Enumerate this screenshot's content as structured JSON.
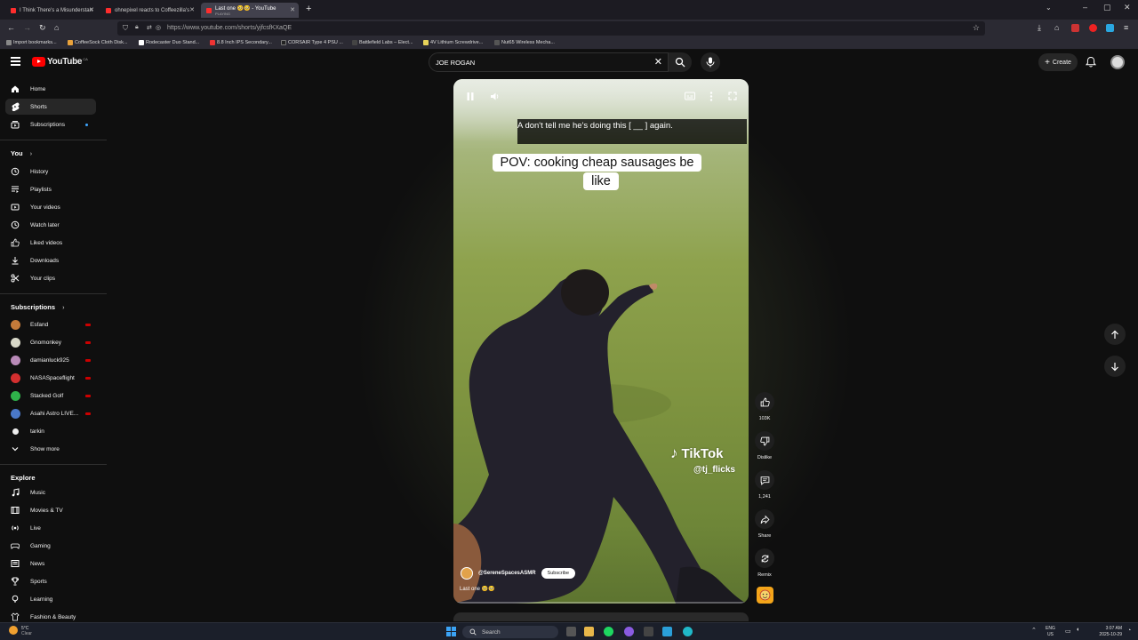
{
  "browser": {
    "tabs": [
      {
        "title": "I Think There's a Misunderstan",
        "active": false
      },
      {
        "title": "ohnepixel reacts to Coffeezilla's",
        "active": false
      },
      {
        "title": "Last one 🥺🥺 - YouTube",
        "subtitle": "PLAYING",
        "active": true
      }
    ],
    "url": "https://www.youtube.com/shorts/yjfcsfKXaQE",
    "bookmarks": [
      "Import bookmarks...",
      "CoffeeSock Cloth Disk...",
      "Rodecaster Duo Stand...",
      "8.8 Inch IPS Secondary...",
      "CORSAIR Type 4 PSU ...",
      "Battlefield Labs – Elect...",
      "4V Lithium Screwdrive...",
      "Nut65 Wireless Mecha..."
    ]
  },
  "header": {
    "logo_text": "YouTube",
    "country": "CA",
    "search_value": "JOE ROGAN",
    "create_label": "Create"
  },
  "sidebar": {
    "main": [
      {
        "label": "Home",
        "icon": "home-icon",
        "active": false
      },
      {
        "label": "Shorts",
        "icon": "shorts-icon",
        "active": true
      },
      {
        "label": "Subscriptions",
        "icon": "subscriptions-icon",
        "active": false
      }
    ],
    "you_heading": "You",
    "you": [
      {
        "label": "History",
        "icon": "history-icon"
      },
      {
        "label": "Playlists",
        "icon": "playlists-icon"
      },
      {
        "label": "Your videos",
        "icon": "your-videos-icon"
      },
      {
        "label": "Watch later",
        "icon": "watch-later-icon"
      },
      {
        "label": "Liked videos",
        "icon": "like-icon"
      },
      {
        "label": "Downloads",
        "icon": "download-icon"
      },
      {
        "label": "Your clips",
        "icon": "scissors-icon"
      }
    ],
    "subs_heading": "Subscriptions",
    "subs": [
      {
        "label": "Esfand",
        "color": "#c47a3a"
      },
      {
        "label": "Gnomonkey",
        "color": "#d8d8c8"
      },
      {
        "label": "damianluck925",
        "color": "#b98ab8"
      },
      {
        "label": "NASASpaceflight",
        "color": "#d32f2f"
      },
      {
        "label": "Stacked Golf",
        "color": "#2fb24a"
      },
      {
        "label": "Asahi Astro LIVE...",
        "color": "#4a78c8"
      },
      {
        "label": "tarkin",
        "color": "#eeeeee"
      }
    ],
    "show_more": "Show more",
    "explore_heading": "Explore",
    "explore": [
      {
        "label": "Music",
        "icon": "music-icon"
      },
      {
        "label": "Movies & TV",
        "icon": "movies-icon"
      },
      {
        "label": "Live",
        "icon": "live-icon"
      },
      {
        "label": "Gaming",
        "icon": "gaming-icon"
      },
      {
        "label": "News",
        "icon": "news-icon"
      },
      {
        "label": "Sports",
        "icon": "trophy-icon"
      },
      {
        "label": "Learning",
        "icon": "learning-icon"
      },
      {
        "label": "Fashion & Beauty",
        "icon": "fashion-icon"
      }
    ]
  },
  "short": {
    "caption": "A don't tell me he's doing this [ __ ] again.",
    "overlay_text": "POV: cooking cheap sausages be like",
    "watermark_name": "TikTok",
    "watermark_handle": "@tj_flicks",
    "channel": "@SereneSpacesASMR",
    "subscribe_label": "Subscribe",
    "title": "Last one 🥺🥺"
  },
  "actions": {
    "like_count": "103K",
    "dislike_label": "Dislike",
    "comment_count": "1,241",
    "share_label": "Share",
    "remix_label": "Remix"
  },
  "taskbar": {
    "weather_temp": "5°C",
    "weather_desc": "Clear",
    "search_label": "Search",
    "lang": "ENG",
    "region": "US",
    "time": "3:07 AM",
    "date": "2025-10-29"
  }
}
